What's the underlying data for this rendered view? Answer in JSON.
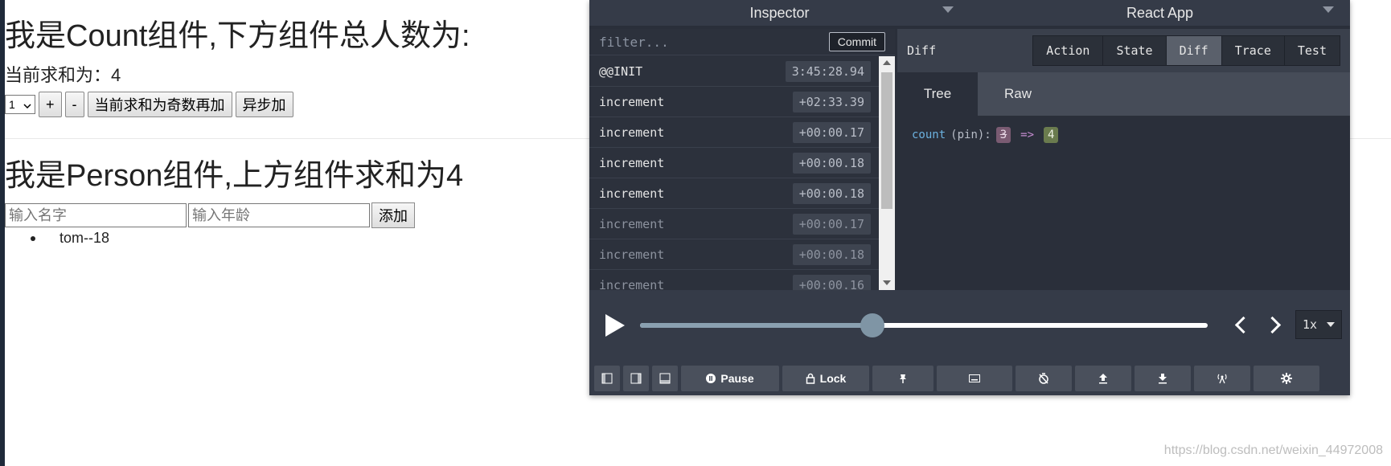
{
  "count": {
    "title": "我是Count组件,下方组件总人数为:",
    "sum_text": "当前求和为：4",
    "select_value": "1",
    "btn_plus": "+",
    "btn_minus": "-",
    "btn_odd": "当前求和为奇数再加",
    "btn_async": "异步加"
  },
  "person": {
    "title": "我是Person组件,上方组件求和为4",
    "name_placeholder": "输入名字",
    "age_placeholder": "输入年龄",
    "btn_add": "添加",
    "list": [
      "tom--18"
    ]
  },
  "devtools": {
    "header_left": "Inspector",
    "header_right": "React App",
    "filter_placeholder": "filter...",
    "commit": "Commit",
    "actions": [
      {
        "name": "@@INIT",
        "time": "3:45:28.94",
        "dim": false
      },
      {
        "name": "increment",
        "time": "+02:33.39",
        "dim": false
      },
      {
        "name": "increment",
        "time": "+00:00.17",
        "dim": false
      },
      {
        "name": "increment",
        "time": "+00:00.18",
        "dim": false
      },
      {
        "name": "increment",
        "time": "+00:00.18",
        "dim": false
      },
      {
        "name": "increment",
        "time": "+00:00.17",
        "dim": true
      },
      {
        "name": "increment",
        "time": "+00:00.18",
        "dim": true
      },
      {
        "name": "increment",
        "time": "+00:00.16",
        "dim": true
      }
    ],
    "right_title": "Diff",
    "segments": [
      "Action",
      "State",
      "Diff",
      "Trace",
      "Test"
    ],
    "active_segment": "Diff",
    "tabs": [
      "Tree",
      "Raw"
    ],
    "active_tab": "Tree",
    "diff": {
      "key": "count",
      "pin": "(pin):",
      "old": "3",
      "arrow": "=>",
      "new": "4"
    },
    "slider_value": 0.41,
    "speed": "1x",
    "pause": "Pause",
    "lock": "Lock"
  },
  "watermark": "https://blog.csdn.net/weixin_44972008"
}
